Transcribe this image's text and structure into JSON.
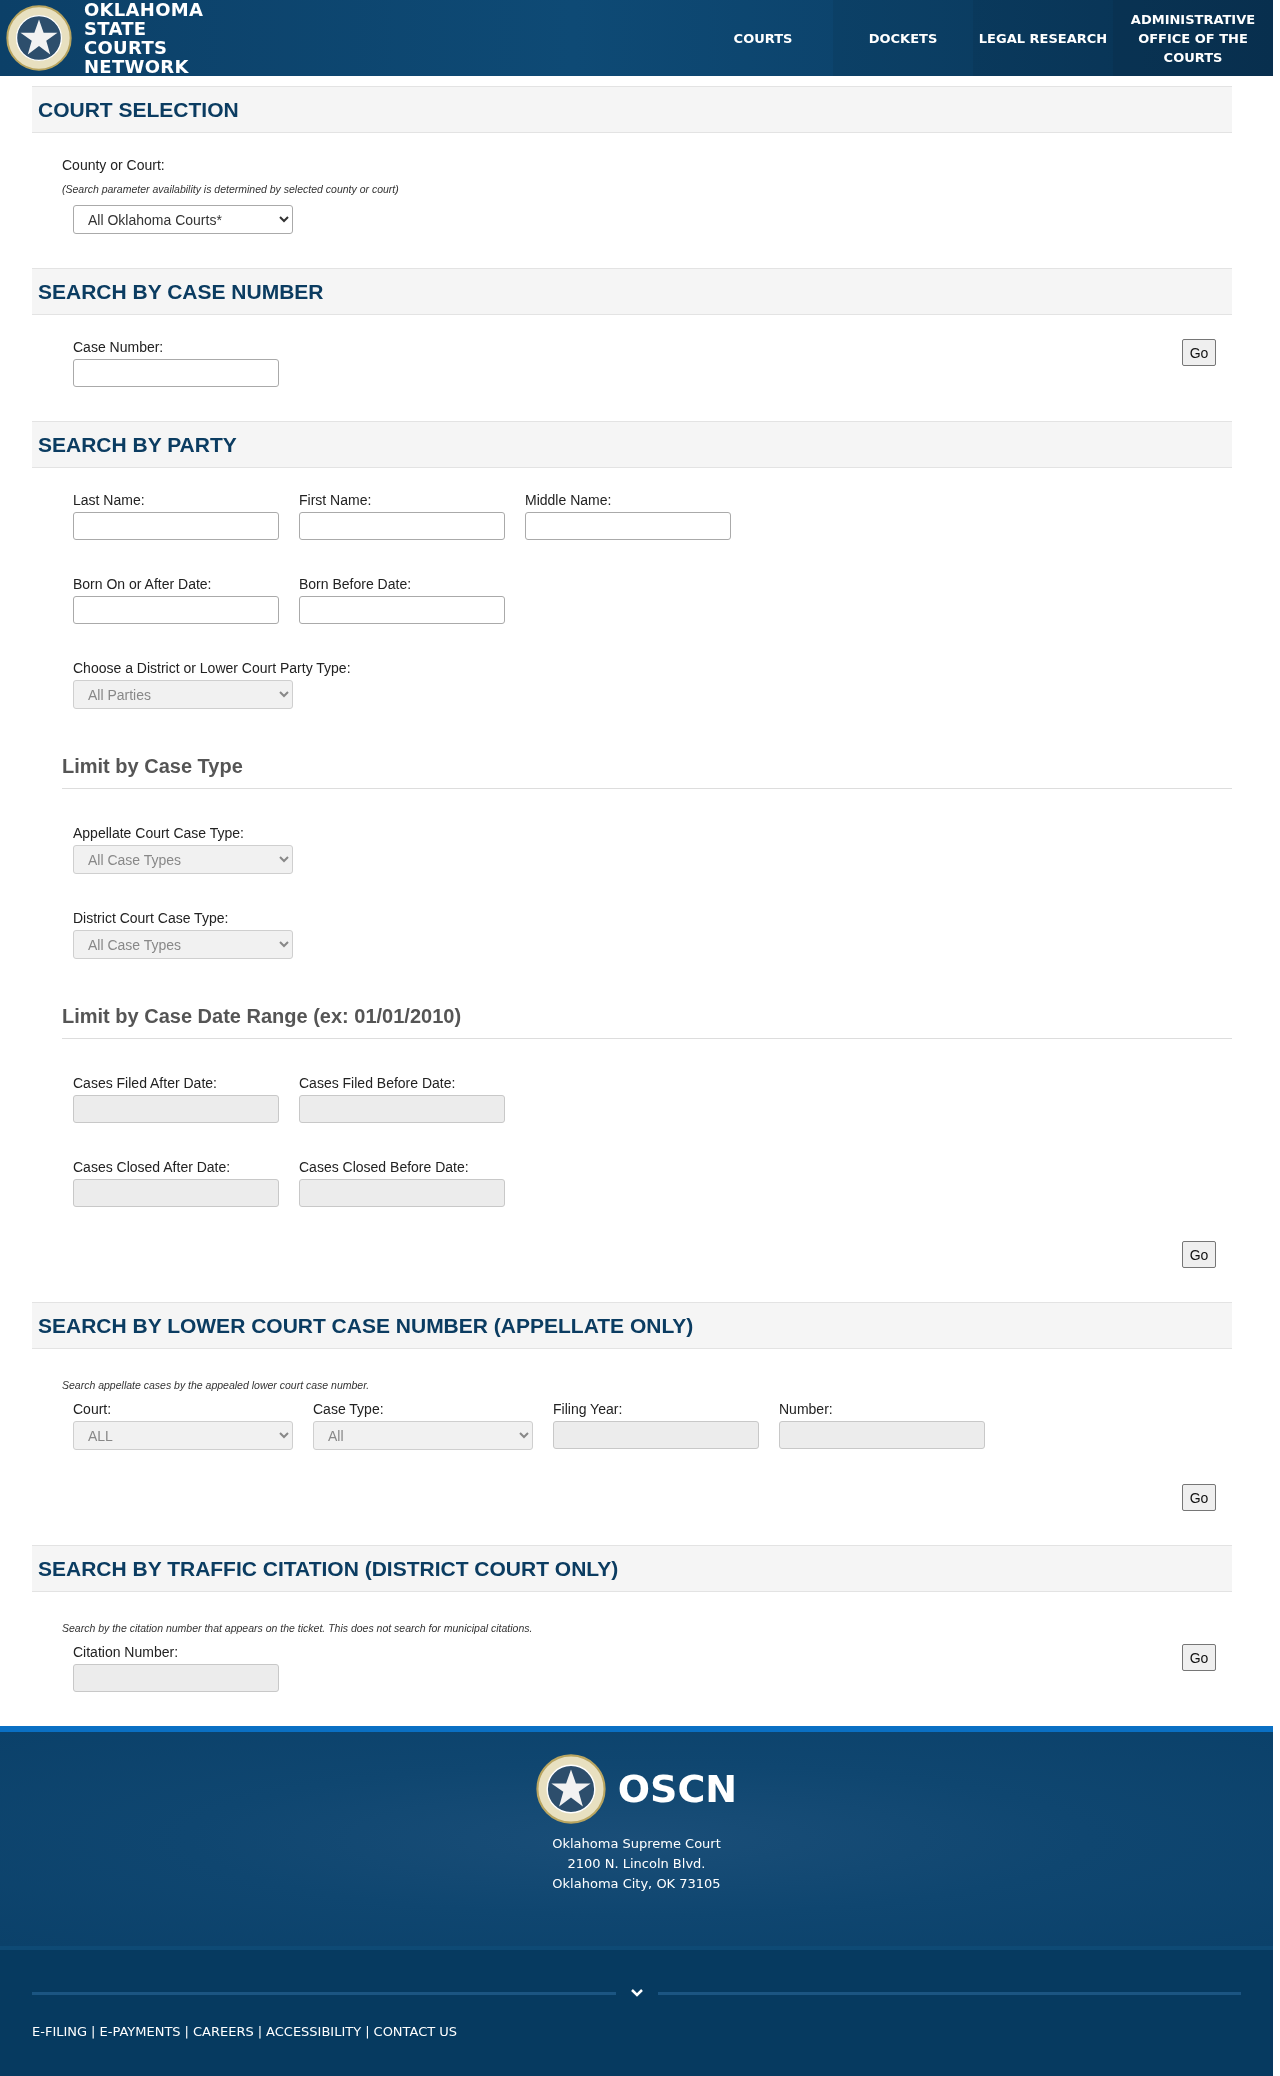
{
  "header": {
    "brand_lines": [
      "OKLAHOMA",
      "STATE",
      "COURTS",
      "NETWORK"
    ],
    "nav": [
      {
        "label": "COURTS"
      },
      {
        "label": "DOCKETS"
      },
      {
        "label": "LEGAL RESEARCH"
      },
      {
        "label": "ADMINISTRATIVE OFFICE OF THE COURTS"
      }
    ]
  },
  "sections": [
    {
      "title": "COURT SELECTION",
      "blocks": [
        {
          "kind": "label",
          "text": "County or Court:"
        },
        {
          "kind": "note",
          "text": "(Search parameter availability is determined by selected county or court)"
        },
        {
          "kind": "row",
          "fields": [
            {
              "kind": "select",
              "value": "All Oklahoma Courts*",
              "disabled": false
            }
          ]
        }
      ]
    },
    {
      "title": "SEARCH BY CASE NUMBER",
      "blocks": [
        {
          "kind": "row",
          "go": "Go",
          "fields": [
            {
              "kind": "text",
              "label": "Case Number:",
              "disabled": false
            }
          ]
        }
      ]
    },
    {
      "title": "SEARCH BY PARTY",
      "blocks": [
        {
          "kind": "row",
          "fields": [
            {
              "kind": "text",
              "label": "Last Name:",
              "disabled": false
            },
            {
              "kind": "text",
              "label": "First Name:",
              "disabled": false
            },
            {
              "kind": "text",
              "label": "Middle Name:",
              "disabled": false
            }
          ]
        },
        {
          "kind": "row",
          "fields": [
            {
              "kind": "text",
              "label": "Born On or After Date:",
              "disabled": false
            },
            {
              "kind": "text",
              "label": "Born Before Date:",
              "disabled": false
            }
          ]
        },
        {
          "kind": "row",
          "fields": [
            {
              "kind": "select",
              "label": "Choose a District or Lower Court Party Type:",
              "value": "All Parties",
              "disabled": true
            }
          ]
        },
        {
          "kind": "subheading",
          "text": "Limit by Case Type"
        },
        {
          "kind": "row",
          "fields": [
            {
              "kind": "select",
              "label": "Appellate Court Case Type:",
              "value": "All Case Types",
              "disabled": true
            }
          ]
        },
        {
          "kind": "row",
          "fields": [
            {
              "kind": "select",
              "label": "District Court Case Type:",
              "value": "All Case Types",
              "disabled": true
            }
          ]
        },
        {
          "kind": "subheading",
          "text": "Limit by Case Date Range (ex: 01/01/2010)"
        },
        {
          "kind": "row",
          "fields": [
            {
              "kind": "text",
              "label": "Cases Filed After Date:",
              "disabled": true
            },
            {
              "kind": "text",
              "label": "Cases Filed Before Date:",
              "disabled": true
            }
          ]
        },
        {
          "kind": "row",
          "fields": [
            {
              "kind": "text",
              "label": "Cases Closed After Date:",
              "disabled": true
            },
            {
              "kind": "text",
              "label": "Cases Closed Before Date:",
              "disabled": true
            }
          ]
        },
        {
          "kind": "go",
          "text": "Go"
        }
      ]
    },
    {
      "title": "SEARCH BY LOWER COURT CASE NUMBER (APPELLATE ONLY)",
      "blocks": [
        {
          "kind": "note",
          "text": "Search appellate cases by the appealed lower court case number."
        },
        {
          "kind": "row",
          "fields": [
            {
              "kind": "select",
              "label": "Court:",
              "value": "ALL",
              "disabled": true
            },
            {
              "kind": "select",
              "label": "Case Type:",
              "value": "All",
              "disabled": true
            },
            {
              "kind": "text",
              "label": "Filing Year:",
              "disabled": true
            },
            {
              "kind": "text",
              "label": "Number:",
              "disabled": true
            }
          ]
        },
        {
          "kind": "go",
          "text": "Go"
        }
      ]
    },
    {
      "title": "SEARCH BY TRAFFIC CITATION (DISTRICT COURT ONLY)",
      "blocks": [
        {
          "kind": "note",
          "text": "Search by the citation number that appears on the ticket. This does not search for municipal citations."
        },
        {
          "kind": "row",
          "go": "Go",
          "fields": [
            {
              "kind": "text",
              "label": "Citation Number:",
              "disabled": true
            }
          ]
        }
      ]
    }
  ],
  "footer": {
    "brand": "OSCN",
    "address": [
      "Oklahoma Supreme Court",
      "2100 N. Lincoln Blvd.",
      "Oklahoma City, OK 73105"
    ],
    "separator": "|",
    "links": [
      "E-FILING",
      "E-PAYMENTS",
      "CAREERS",
      "ACCESSIBILITY",
      "CONTACT US"
    ]
  }
}
